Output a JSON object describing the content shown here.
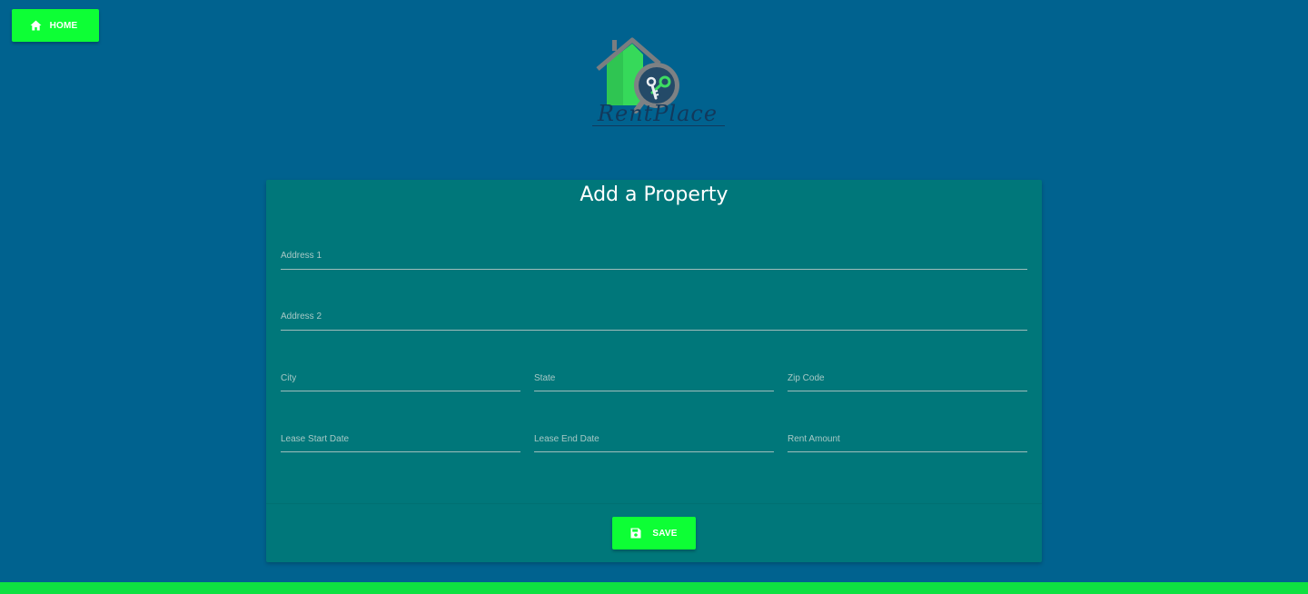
{
  "header": {
    "home_button": {
      "label": "HOME",
      "icon": "home-icon"
    }
  },
  "logo": {
    "text": "RentPlace",
    "icons": [
      "house-icon",
      "magnifier-icon",
      "key-icon"
    ]
  },
  "form": {
    "title": "Add a Property",
    "fields": {
      "address1": {
        "label": "Address 1",
        "value": ""
      },
      "address2": {
        "label": "Address 2",
        "value": ""
      },
      "city": {
        "label": "City",
        "value": ""
      },
      "state": {
        "label": "State",
        "value": ""
      },
      "zip": {
        "label": "Zip Code",
        "value": ""
      },
      "lease_start": {
        "label": "Lease Start Date",
        "value": ""
      },
      "lease_end": {
        "label": "Lease End Date",
        "value": ""
      },
      "rent": {
        "label": "Rent Amount",
        "value": ""
      }
    },
    "save_button": {
      "label": "SAVE",
      "icon": "floppy-disk-icon"
    }
  },
  "colors": {
    "page_background": "#00628f",
    "card_background": "#00777a",
    "button_green": "#0dff35",
    "footer_green": "#0fe042"
  }
}
